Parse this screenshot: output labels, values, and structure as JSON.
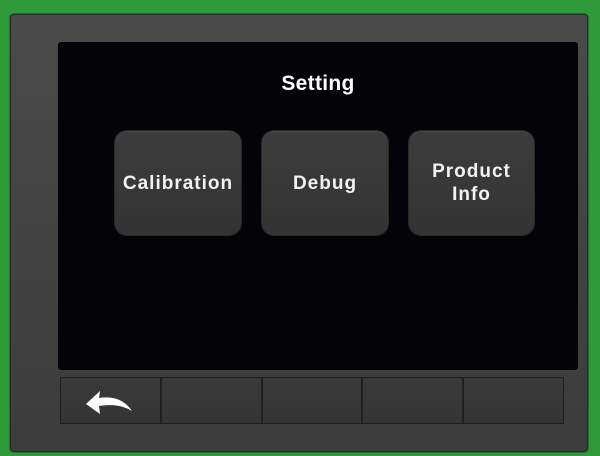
{
  "screen": {
    "title": "Setting"
  },
  "buttons": [
    {
      "label": "Calibration"
    },
    {
      "label": "Debug"
    },
    {
      "label": "Product\nInfo"
    }
  ],
  "toolbar": {
    "slots": [
      {
        "icon": "back-arrow-icon"
      },
      {
        "icon": ""
      },
      {
        "icon": ""
      },
      {
        "icon": ""
      },
      {
        "icon": ""
      }
    ]
  },
  "colors": {
    "background": "#2f9a3a",
    "bezel": "#444444",
    "screen": "#030308",
    "button": "#383838",
    "text": "#ffffff"
  }
}
